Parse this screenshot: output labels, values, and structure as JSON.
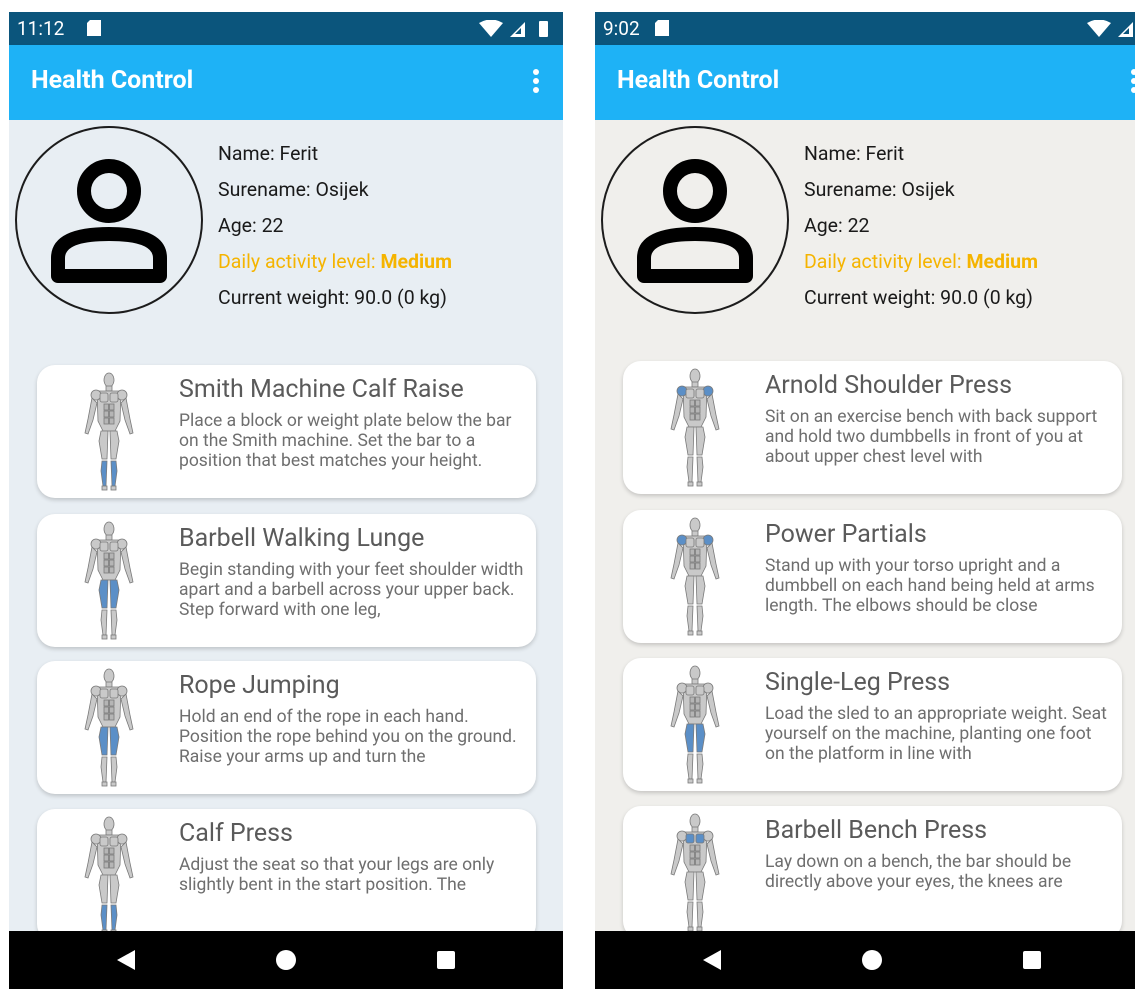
{
  "screens": [
    {
      "status": {
        "time": "11:12"
      },
      "appbar": {
        "title": "Health Control"
      },
      "profile": {
        "name": "Name: Ferit",
        "surname": "Surename: Osijek",
        "age": "Age: 22",
        "activity_label": "Daily activity level: ",
        "activity_value": "Medium",
        "weight": "Current weight: 90.0  (0 kg)"
      },
      "exercises": [
        {
          "title": "Smith Machine Calf Raise",
          "desc": "Place a block or weight plate below the bar on the Smith machine. Set the bar to a position that best matches your height.",
          "muscle": "calves"
        },
        {
          "title": "Barbell Walking Lunge",
          "desc": "Begin standing with your feet shoulder width apart and a barbell across your upper back. Step forward with one leg,",
          "muscle": "quads"
        },
        {
          "title": "Rope Jumping",
          "desc": "Hold an end of the rope in each hand. Position the rope behind you on the ground. Raise your arms up and turn the",
          "muscle": "quads"
        },
        {
          "title": "Calf Press",
          "desc": "Adjust the seat so that your legs are only slightly bent in the start position. The",
          "muscle": "calves"
        }
      ]
    },
    {
      "status": {
        "time": "9:02"
      },
      "appbar": {
        "title": "Health Control"
      },
      "profile": {
        "name": "Name: Ferit",
        "surname": "Surename: Osijek",
        "age": "Age: 22",
        "activity_label": "Daily activity level: ",
        "activity_value": "Medium",
        "weight": "Current weight: 90.0  (0 kg)"
      },
      "exercises": [
        {
          "title": "Arnold Shoulder Press",
          "desc": "Sit on an exercise bench with back support and hold two dumbbells in front of you at about upper chest level with",
          "muscle": "shoulders"
        },
        {
          "title": "Power Partials",
          "desc": "Stand up with your torso upright and a dumbbell on each hand being held at arms length. The elbows should be close",
          "muscle": "shoulders"
        },
        {
          "title": "Single-Leg Press",
          "desc": "Load the sled to an appropriate weight. Seat yourself on the machine, planting one foot on the platform in line with",
          "muscle": "quads"
        },
        {
          "title": "Barbell Bench Press",
          "desc": "Lay down on a bench, the bar should be directly above your eyes, the knees are",
          "muscle": "chest"
        }
      ]
    }
  ],
  "colors": {
    "statusbar": "#0b557c",
    "appbar": "#1eb2f6",
    "activity": "#f5b400",
    "highlight_muscle": "#5b8fc7"
  },
  "icons": [
    "sd-card-icon",
    "wifi-icon",
    "signal-icon",
    "battery-icon",
    "overflow-menu-icon",
    "avatar-icon",
    "back-icon",
    "home-icon",
    "recents-icon"
  ]
}
